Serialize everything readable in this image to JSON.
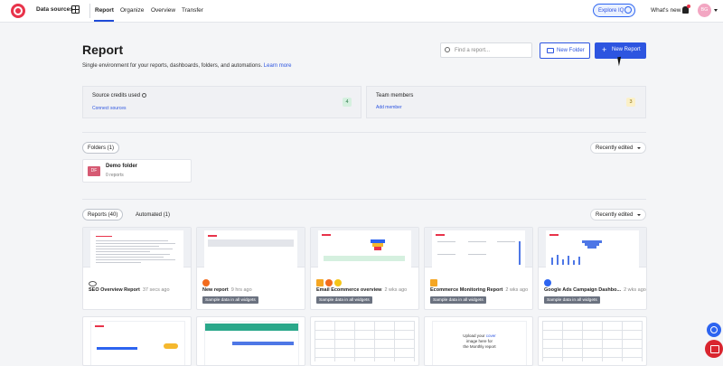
{
  "topbar": {
    "data_sources": "Data sources",
    "tabs": [
      "Report",
      "Organize",
      "Overview",
      "Transfer"
    ],
    "explore": "Explore IQ",
    "whats_new": "What's new",
    "avatar_initials": "BG"
  },
  "page": {
    "title": "Report",
    "subtitle": "Single environment for your reports, dashboards, folders, and automations.",
    "learn_more": "Learn more",
    "search_placeholder": "Find a report...",
    "new_folder": "New Folder",
    "new_report": "New Report"
  },
  "stats": [
    {
      "title": "Source credits used",
      "link": "Connect sources",
      "value": "4",
      "color": "#d5f0df"
    },
    {
      "title": "Team members",
      "link": "Add member",
      "value": "3",
      "color": "#fbf0c8"
    }
  ],
  "folders": {
    "pill": "Folders (1)",
    "sort": "Recently edited",
    "items": [
      {
        "abbr": "DF",
        "name": "Demo folder",
        "count": "0 reports"
      }
    ]
  },
  "reports": {
    "tabs": [
      "Reports (40)",
      "Automated (1)"
    ],
    "sort": "Recently edited",
    "badge": "Sample data in all widgets",
    "items": [
      {
        "name": "SEO Overview Report",
        "time": "37 secs ago",
        "badge": false
      },
      {
        "name": "New report",
        "time": "9 hrs ago",
        "badge": true
      },
      {
        "name": "Email Ecommerce overview",
        "time": "2 wks ago",
        "badge": true
      },
      {
        "name": "Ecommerce Monitoring Report",
        "time": "2 wks ago",
        "badge": true
      },
      {
        "name": "Google Ads Campaign Dashbo...",
        "time": "2 wks ago",
        "badge": true
      }
    ]
  },
  "second_row": {
    "caption_line1": "Upload your",
    "caption_word": "cover",
    "caption_line2": "image here for",
    "caption_line3": "the Monthly report"
  }
}
